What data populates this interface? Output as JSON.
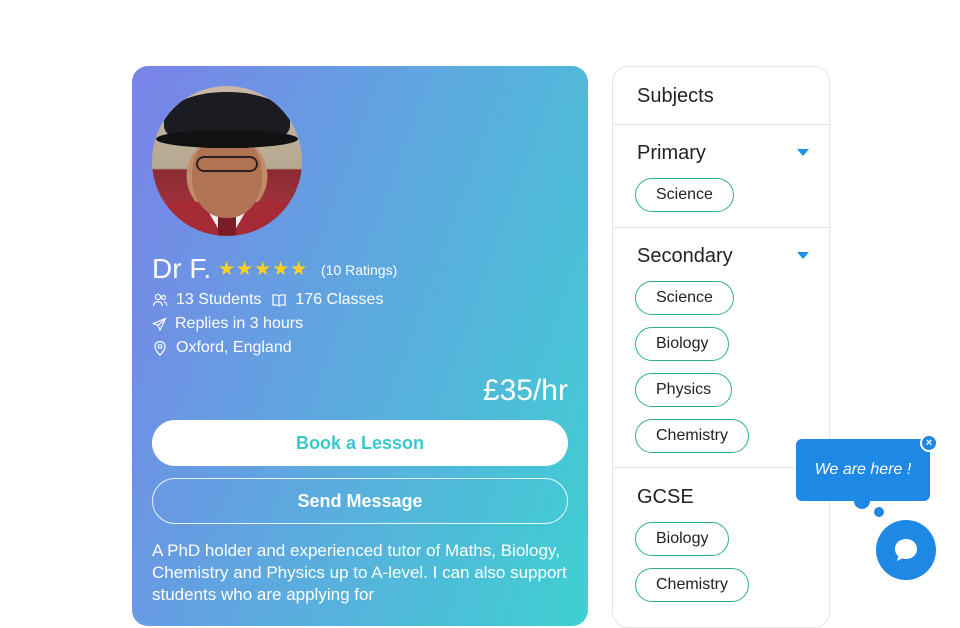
{
  "profile": {
    "name": "Dr F.",
    "stars": "★★★★★",
    "rating_value": 5,
    "ratings_count": "(10 Ratings)",
    "students": "13 Students",
    "classes": "176 Classes",
    "replies": "Replies in 3 hours",
    "location": "Oxford, England",
    "price": "£35/hr",
    "book_label": "Book a Lesson",
    "message_label": "Send Message",
    "bio": "A PhD holder and experienced tutor of Maths, Biology, Chemistry and Physics up to A-level. I can also support students who are applying for"
  },
  "subjects": {
    "title": "Subjects",
    "sections": [
      {
        "heading": "Primary",
        "expandable": true,
        "chips": [
          "Science"
        ]
      },
      {
        "heading": "Secondary",
        "expandable": true,
        "chips": [
          "Science",
          "Biology",
          "Physics",
          "Chemistry"
        ]
      },
      {
        "heading": "GCSE",
        "expandable": false,
        "chips": [
          "Biology",
          "Chemistry"
        ]
      }
    ]
  },
  "chat": {
    "message": "We are here !",
    "close_label": "×"
  },
  "colors": {
    "card_gradient_start": "#7b82e8",
    "card_gradient_end": "#3fd0d2",
    "star": "#ffd21a",
    "chip_border": "#2fb37c",
    "chat_blue": "#1e88e5"
  },
  "icons": [
    "students-icon",
    "book-icon",
    "send-icon",
    "location-pin-icon",
    "caret-down-icon",
    "close-icon",
    "chat-icon"
  ]
}
